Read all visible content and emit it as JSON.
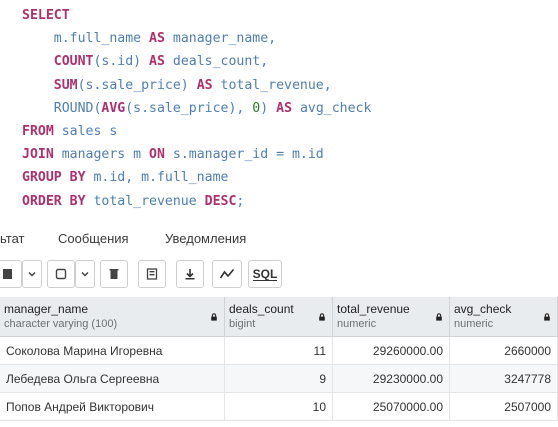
{
  "editor": {
    "lines": [
      [
        {
          "t": "SELECT",
          "c": "kw"
        }
      ],
      [
        {
          "t": "    m.full_name ",
          "c": ""
        },
        {
          "t": "AS",
          "c": "kw"
        },
        {
          "t": " manager_name,",
          "c": ""
        }
      ],
      [
        {
          "t": "    ",
          "c": ""
        },
        {
          "t": "COUNT",
          "c": "kw"
        },
        {
          "t": "(s.id) ",
          "c": ""
        },
        {
          "t": "AS",
          "c": "kw"
        },
        {
          "t": " deals_count,",
          "c": ""
        }
      ],
      [
        {
          "t": "    ",
          "c": ""
        },
        {
          "t": "SUM",
          "c": "kw"
        },
        {
          "t": "(s.sale_price) ",
          "c": ""
        },
        {
          "t": "AS",
          "c": "kw"
        },
        {
          "t": " total_revenue,",
          "c": ""
        }
      ],
      [
        {
          "t": "    ROUND(",
          "c": ""
        },
        {
          "t": "AVG",
          "c": "kw"
        },
        {
          "t": "(s.sale_price), ",
          "c": ""
        },
        {
          "t": "0",
          "c": "num"
        },
        {
          "t": ") ",
          "c": ""
        },
        {
          "t": "AS",
          "c": "kw"
        },
        {
          "t": " avg_check",
          "c": ""
        }
      ],
      [
        {
          "t": "FROM",
          "c": "kw"
        },
        {
          "t": " sales s",
          "c": ""
        }
      ],
      [
        {
          "t": "JOIN",
          "c": "kw"
        },
        {
          "t": " managers m ",
          "c": ""
        },
        {
          "t": "ON",
          "c": "kw"
        },
        {
          "t": " s.manager_id = m.id",
          "c": ""
        }
      ],
      [
        {
          "t": "GROUP BY",
          "c": "kw"
        },
        {
          "t": " m.id, m.full_name",
          "c": ""
        }
      ],
      [
        {
          "t": "ORDER BY",
          "c": "kw"
        },
        {
          "t": " total_revenue ",
          "c": ""
        },
        {
          "t": "DESC",
          "c": "kw"
        },
        {
          "t": ";",
          "c": ""
        }
      ]
    ]
  },
  "tabs": {
    "result": "ьтат",
    "messages": "Сообщения",
    "notifications": "Уведомления"
  },
  "toolbar": {
    "sql_label": "SQL"
  },
  "columns": [
    {
      "name": "manager_name",
      "type": "character varying (100)"
    },
    {
      "name": "deals_count",
      "type": "bigint"
    },
    {
      "name": "total_revenue",
      "type": "numeric"
    },
    {
      "name": "avg_check",
      "type": "numeric"
    }
  ],
  "rows": [
    [
      "Соколова Марина Игоревна",
      "11",
      "29260000.00",
      "2660000"
    ],
    [
      "Лебедева Ольга Сергеевна",
      "9",
      "29230000.00",
      "3247778"
    ],
    [
      "Попов Андрей Викторович",
      "10",
      "25070000.00",
      "2507000"
    ]
  ]
}
